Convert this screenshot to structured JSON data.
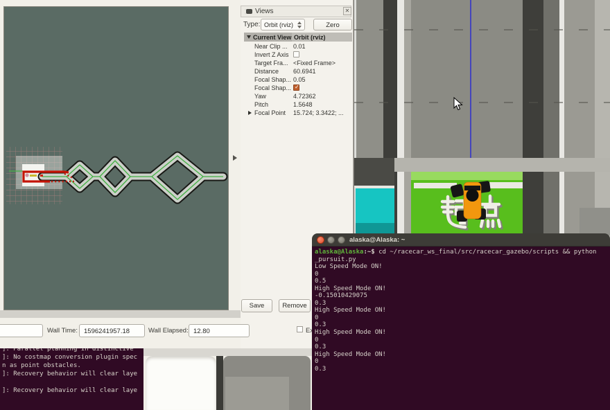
{
  "views_panel": {
    "title": "Views",
    "type_label": "Type:",
    "type_value": "Orbit (rviz)",
    "zero_button": "Zero",
    "tree_header_name": "Current View",
    "tree_header_value": "Orbit (rviz)",
    "properties": [
      {
        "label": "Near Clip ...",
        "value": "0.01"
      },
      {
        "label": "Invert Z Axis",
        "value": ""
      },
      {
        "label": "Target Fra...",
        "value": "<Fixed Frame>"
      },
      {
        "label": "Distance",
        "value": "60.6941"
      },
      {
        "label": "Focal Shap...",
        "value": "0.05"
      },
      {
        "label": "Focal Shap...",
        "value": ""
      },
      {
        "label": "Yaw",
        "value": "4.72362"
      },
      {
        "label": "Pitch",
        "value": "1.5648"
      },
      {
        "label": "Focal Point",
        "value": "15.724; 3.3422; ..."
      }
    ],
    "save_button": "Save",
    "remove_button": "Remove"
  },
  "time_bar": {
    "wall_time_label": "Wall Time:",
    "wall_time_value": "1596241957.18",
    "wall_elapsed_label": "Wall Elapsed:",
    "wall_elapsed_value": "12.80",
    "experimental_label": "Ex"
  },
  "gazebo": {
    "ground_text": "起点"
  },
  "terminal": {
    "title": "alaska@Alaska: ~",
    "prompt_user": "alaska@Alaska",
    "prompt_rest": ":~$",
    "command": " cd ~/racecar_ws_final/src/racecar_gazebo/scripts && python",
    "lines": [
      "_pursuit.py",
      "Low Speed Mode ON!",
      "0",
      "0.5",
      "High Speed Mode ON!",
      "-0.15010429075",
      "0.3",
      "High Speed Mode ON!",
      "0",
      "0.3",
      "High Speed Mode ON!",
      "0",
      "0.3",
      "High Speed Mode ON!",
      "0",
      "0.3"
    ]
  },
  "log_terminal": {
    "lines": [
      "]: Parallel planning in distinctive",
      "]: No costmap conversion plugin spec",
      "n as point obstacles.",
      "]: Recovery behavior will clear laye",
      "",
      "]: Recovery behavior will clear laye"
    ]
  },
  "colors": {
    "viewport_teal": "#5a6b64",
    "track_green_line": "#43b143",
    "path_red": "#c41405",
    "ground_green": "#58be1d",
    "cyan_block": "#16c5c2",
    "car_orange": "#f2970e",
    "terminal_bg": "#300a24",
    "terminal_green": "#5fb33a"
  }
}
